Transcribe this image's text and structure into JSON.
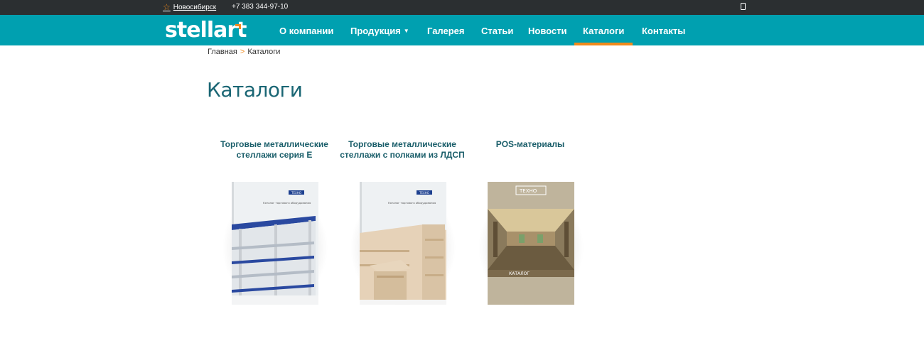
{
  "topbar": {
    "city": "Новосибирск",
    "phone": "+7 383 344-97-10"
  },
  "header": {
    "logo_text": "stellart"
  },
  "nav": {
    "items": [
      {
        "label": "О компании"
      },
      {
        "label": "Продукция"
      },
      {
        "label": "Галерея"
      },
      {
        "label": "Статьи"
      },
      {
        "label": "Новости"
      },
      {
        "label": "Каталоги"
      },
      {
        "label": "Контакты"
      }
    ]
  },
  "breadcrumb": {
    "home": "Главная",
    "separator": ">",
    "current": "Каталоги"
  },
  "page": {
    "title": "Каталоги"
  },
  "catalogs": [
    {
      "title": "Торговые металлические стеллажи серия Е",
      "cover_caption": "Каталог торгового оборудования",
      "brand": "ТЕХНО"
    },
    {
      "title": "Торговые металлические стеллажи с полками из ЛДСП",
      "cover_caption": "Каталог торгового оборудования",
      "brand": "ТЕХНО"
    },
    {
      "title": "POS-материалы",
      "cover_caption": "КАТАЛОГ",
      "brand": "ТЕХНО"
    }
  ],
  "colors": {
    "topbar": "#2b2f31",
    "nav": "#00a0b0",
    "accent": "#f08a1c",
    "title": "#1a6674"
  }
}
